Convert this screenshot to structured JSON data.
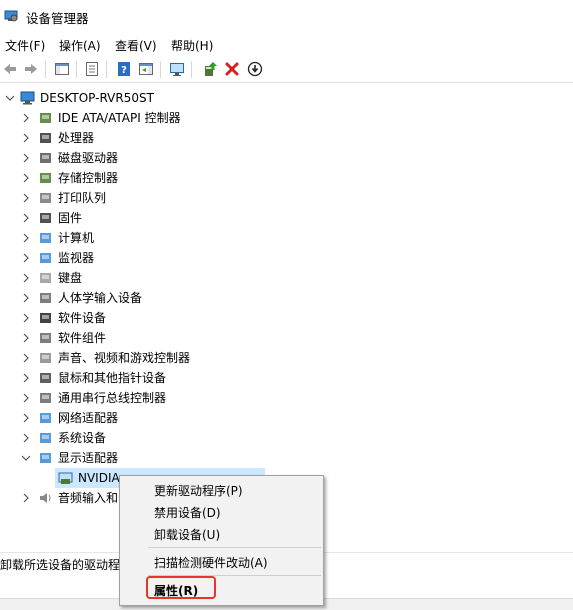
{
  "window": {
    "title": "设备管理器",
    "app_icon": "device-manager-icon"
  },
  "menu": [
    "文件(F)",
    "操作(A)",
    "查看(V)",
    "帮助(H)"
  ],
  "toolbar": {
    "icons": [
      "back-arrow-icon",
      "forward-arrow-icon",
      "show-hide-console-tree-icon",
      "properties-icon",
      "help-icon",
      "action-pane-icon",
      "monitor-scan-icon",
      "update-driver-icon",
      "uninstall-icon",
      "disable-device-icon"
    ]
  },
  "tree": {
    "root": "DESKTOP-RVR50ST",
    "categories": [
      "IDE ATA/ATAPI 控制器",
      "处理器",
      "磁盘驱动器",
      "存储控制器",
      "打印队列",
      "固件",
      "计算机",
      "监视器",
      "键盘",
      "人体学输入设备",
      "软件设备",
      "软件组件",
      "声音、视频和游戏控制器",
      "鼠标和其他指针设备",
      "通用串行总线控制器",
      "网络适配器",
      "系统设备",
      "显示适配器"
    ],
    "selected_child": "NVIDIA",
    "after_expanded": "音频输入和"
  },
  "context_menu": {
    "items": [
      "更新驱动程序(P)",
      "禁用设备(D)",
      "卸载设备(U)",
      "扫描检测硬件改动(A)",
      "属性(R)"
    ],
    "highlight_color": "#e8342a"
  },
  "status": {
    "text": "卸载所选设备的驱动程序"
  },
  "colors": {
    "uninstall_x": "#d62020",
    "help": "#2b6cc4",
    "selection_bg": "#cce8ff"
  }
}
